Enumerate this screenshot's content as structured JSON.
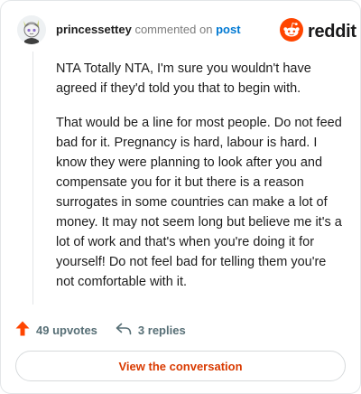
{
  "comment": {
    "username": "princessettey",
    "action_text": "commented on",
    "target_text": "post",
    "paragraphs": [
      "NTA Totally NTA, I'm sure you wouldn't have agreed if they'd told you that to begin with.",
      "That would be a line for most people. Do not feed bad for it. Pregnancy is hard, labour is hard. I know they were planning to look after you and compensate you for it but there is a reason surrogates in some countries can make a lot of money. It may not seem long but believe me it's a lot of work and that's when you're doing it for yourself! Do not feel bad for telling them you're not comfortable with it."
    ],
    "upvotes_label": "49 upvotes",
    "replies_label": "3 replies"
  },
  "brand": {
    "wordmark": "reddit",
    "accent": "#ff4500",
    "link_color": "#0079d3",
    "cta_color": "#d93a00"
  },
  "icons": {
    "upvote": "upvote-arrow-icon",
    "reply": "reply-arrow-icon",
    "logo": "reddit-alien-icon"
  },
  "cta": {
    "label": "View the conversation"
  }
}
